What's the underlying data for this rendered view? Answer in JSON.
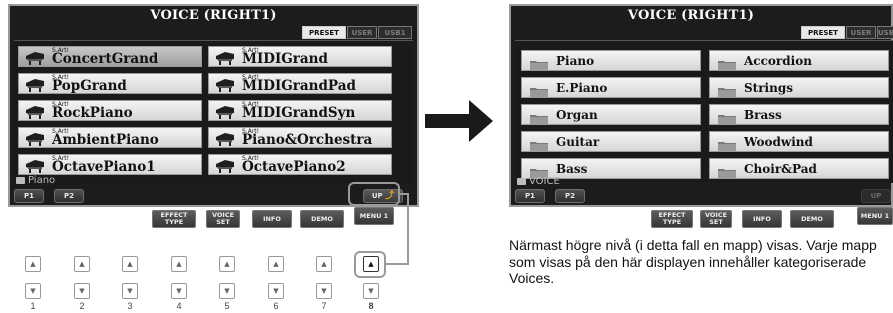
{
  "left_screen": {
    "title": "VOICE (RIGHT1)",
    "tabs": [
      "PRESET",
      "USER",
      "USB1"
    ],
    "voices": [
      {
        "tag": "S.Art!",
        "name": "ConcertGrand"
      },
      {
        "tag": "S.Art!",
        "name": "MIDIGrand"
      },
      {
        "tag": "S.Art!",
        "name": "PopGrand"
      },
      {
        "tag": "S.Art!",
        "name": "MIDIGrandPad"
      },
      {
        "tag": "S.Art!",
        "name": "RockPiano"
      },
      {
        "tag": "S.Art!",
        "name": "MIDIGrandSyn"
      },
      {
        "tag": "S.Art!",
        "name": "AmbientPiano"
      },
      {
        "tag": "S.Art!",
        "name": "Piano&Orchestra"
      },
      {
        "tag": "S.Art!",
        "name": "OctavePiano1"
      },
      {
        "tag": "S.Art!",
        "name": "OctavePiano2"
      }
    ],
    "path": "Piano",
    "pages": [
      "P1",
      "P2"
    ],
    "up_label": "UP",
    "buttons": [
      {
        "l1": "EFFECT",
        "l2": "TYPE"
      },
      {
        "l1": "VOICE",
        "l2": "SET"
      },
      {
        "l1": "INFO",
        "l2": ""
      },
      {
        "l1": "DEMO",
        "l2": ""
      },
      {
        "l1": "MENU 1",
        "l2": ""
      }
    ]
  },
  "right_screen": {
    "title": "VOICE (RIGHT1)",
    "tabs": [
      "PRESET",
      "USER",
      "USB1"
    ],
    "folders": [
      "Piano",
      "Accordion",
      "E.Piano",
      "Strings",
      "Organ",
      "Brass",
      "Guitar",
      "Woodwind",
      "Bass",
      "Choir&Pad"
    ],
    "path": "VOICE",
    "pages": [
      "P1",
      "P2"
    ],
    "up_label": "UP",
    "buttons": [
      {
        "l1": "EFFECT",
        "l2": "TYPE"
      },
      {
        "l1": "VOICE",
        "l2": "SET"
      },
      {
        "l1": "INFO",
        "l2": ""
      },
      {
        "l1": "DEMO",
        "l2": ""
      },
      {
        "l1": "MENU 1",
        "l2": ""
      }
    ]
  },
  "panel_buttons": {
    "up_symbol": "▲",
    "down_symbol": "▼",
    "numbers": [
      "1",
      "2",
      "3",
      "4",
      "5",
      "6",
      "7",
      "8"
    ]
  },
  "caption": "Närmast högre nivå (i detta fall en mapp) visas. Varje mapp som visas på den här displayen innehåller kategoriserade Voices.",
  "colors": {
    "screen_bg": "#1c1c1c",
    "item_bg": "#e6e6e6",
    "highlight": "#9a9a9a",
    "arrow": "#1a1a1a"
  }
}
